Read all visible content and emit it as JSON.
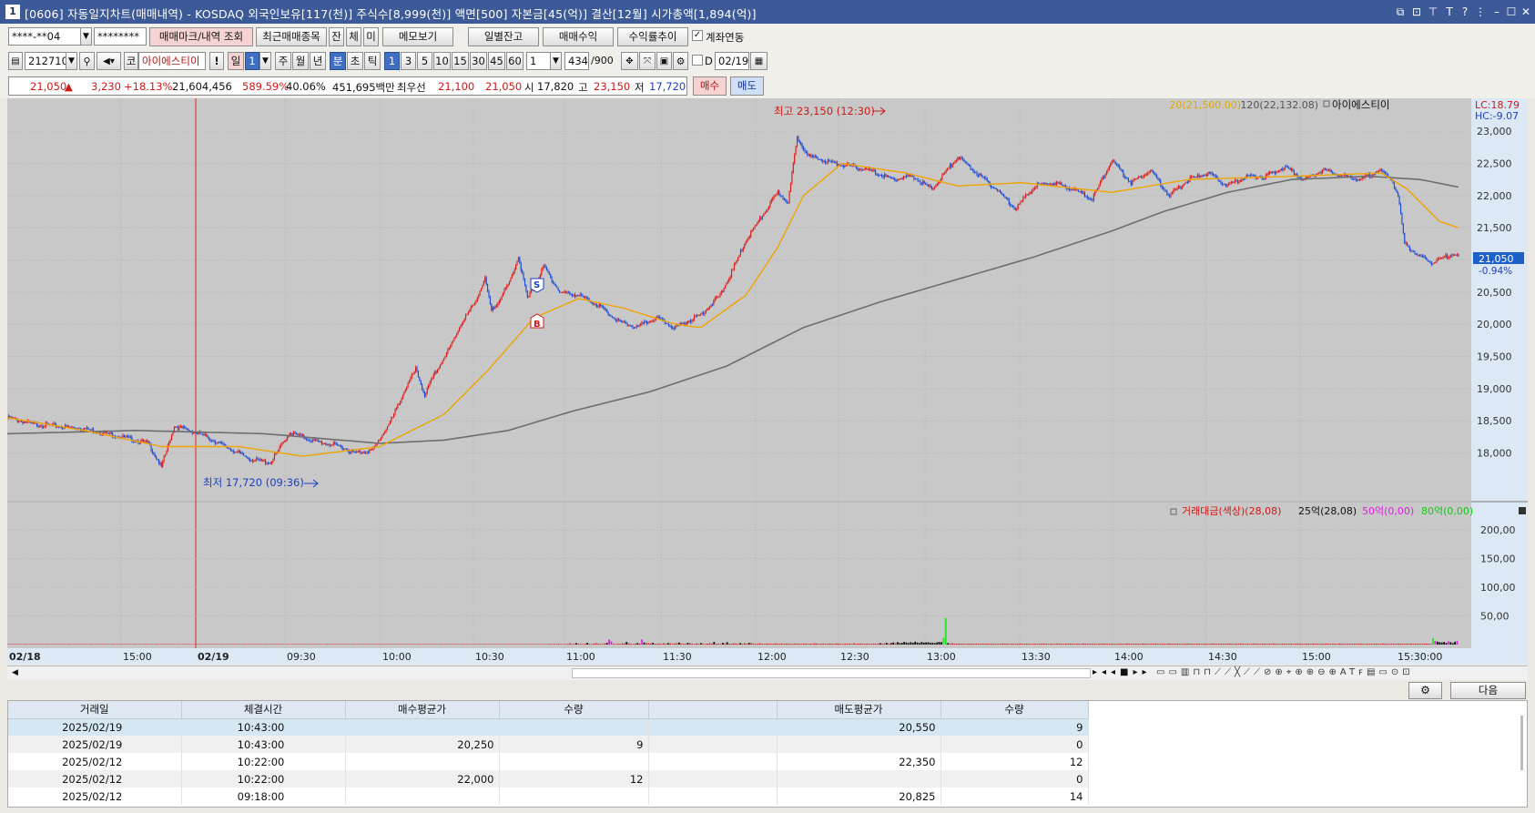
{
  "window": {
    "num": "1",
    "title": "[0606] 자동일지차트(매매내역) - KOSDAQ 외국인보유[117(천)] 주식수[8,999(천)] 액면[500] 자본금[45(억)] 결산[12월] 시가총액[1,894(억)]"
  },
  "toolbar1": {
    "account": "****-**04",
    "password": "********",
    "b1": "매매마크/내역 조회",
    "b2": "최근매매종목",
    "b3": "잔",
    "b4": "체",
    "b5": "미",
    "b6": "메모보기",
    "b7": "일별잔고",
    "b8": "매매수익",
    "b9": "수익률추이",
    "chk": "계좌연동"
  },
  "toolbar2": {
    "code": "212710",
    "mk": "코",
    "name": "아이에스티이",
    "bang": "!",
    "il": "일",
    "ilnum": "1",
    "ju": "주",
    "wol": "월",
    "nyeon": "년",
    "bun": "분",
    "cho": "초",
    "tik": "틱",
    "periods": [
      "1",
      "3",
      "5",
      "10",
      "15",
      "30",
      "45",
      "60"
    ],
    "unit": "1",
    "count": "434",
    "total": "/900",
    "d": "D",
    "date": "02/19"
  },
  "toolbar3": {
    "price": "21,050",
    "arrow": "▲",
    "chg": "3,230",
    "pct": "+18.13%",
    "vol": "21,604,456",
    "volpct": "589.59%",
    "r2": "40.06%",
    "amt": "451,695백만",
    "qlbl": "최우선",
    "ask": "21,100",
    "bid": "21,050",
    "olbl": "시",
    "open": "17,820",
    "hlbl": "고",
    "high": "23,150",
    "llbl": "저",
    "low": "17,720",
    "buy": "매수",
    "sell": "매도"
  },
  "chart_data": {
    "type": "candlestick",
    "legend": {
      "ma20": "20(21,500.00)",
      "ma120": "120(22,132.08)",
      "name": "아이에스티이",
      "lc": "LC:18.79",
      "hc": "HC:-9.07"
    },
    "price_axis": [
      "23,000",
      "22,500",
      "22,000",
      "21,500",
      "21,000",
      "20,500",
      "20,000",
      "19,500",
      "19,000",
      "18,500",
      "18,000"
    ],
    "ylim": [
      17400,
      23200
    ],
    "current": {
      "price": "21,050",
      "pct": "-0.94%",
      "value": 21050
    },
    "annotations": {
      "high": "최고 23,150 (12:30)",
      "low": "최저 17,720 (09:36)",
      "s": "S",
      "b": "B"
    },
    "volume_legend": {
      "title": "거래대금(색상)(28,08)",
      "l25": "25억(28,08)",
      "l50": "50억(0,00)",
      "l80": "80억(0,00)"
    },
    "volume_axis": [
      "200,00",
      "150,00",
      "100,00",
      "50,00"
    ],
    "time_axis": [
      "02/18",
      "15:00",
      "02/19",
      "09:30",
      "10:00",
      "10:30",
      "11:00",
      "11:30",
      "12:00",
      "12:30",
      "13:00",
      "13:30",
      "14:00",
      "14:30",
      "15:00",
      "15:30:00"
    ],
    "path_keypoints": [
      [
        0,
        18550
      ],
      [
        20,
        18450
      ],
      [
        60,
        18380
      ],
      [
        90,
        18250
      ],
      [
        110,
        18150
      ],
      [
        120,
        17780
      ],
      [
        130,
        18420
      ],
      [
        150,
        18300
      ],
      [
        170,
        18100
      ],
      [
        190,
        17900
      ],
      [
        205,
        17850
      ],
      [
        220,
        18320
      ],
      [
        240,
        18180
      ],
      [
        260,
        18100
      ],
      [
        270,
        18000
      ],
      [
        285,
        18050
      ],
      [
        300,
        18550
      ],
      [
        310,
        19000
      ],
      [
        318,
        19300
      ],
      [
        325,
        18900
      ],
      [
        332,
        19200
      ],
      [
        345,
        19650
      ],
      [
        353,
        20000
      ],
      [
        363,
        20300
      ],
      [
        372,
        20700
      ],
      [
        377,
        20200
      ],
      [
        390,
        20600
      ],
      [
        398,
        21050
      ],
      [
        405,
        20400
      ],
      [
        418,
        20900
      ],
      [
        430,
        20500
      ],
      [
        445,
        20450
      ],
      [
        460,
        20300
      ],
      [
        475,
        20050
      ],
      [
        490,
        19950
      ],
      [
        505,
        20100
      ],
      [
        520,
        19950
      ],
      [
        540,
        20150
      ],
      [
        555,
        20450
      ],
      [
        565,
        20850
      ],
      [
        575,
        21300
      ],
      [
        590,
        21750
      ],
      [
        600,
        22050
      ],
      [
        608,
        21900
      ],
      [
        615,
        22900
      ],
      [
        625,
        22600
      ],
      [
        645,
        22500
      ],
      [
        670,
        22400
      ],
      [
        690,
        22250
      ],
      [
        705,
        22300
      ],
      [
        720,
        22100
      ],
      [
        740,
        22600
      ],
      [
        752,
        22400
      ],
      [
        770,
        22100
      ],
      [
        785,
        21800
      ],
      [
        800,
        22150
      ],
      [
        815,
        22200
      ],
      [
        830,
        22100
      ],
      [
        845,
        21950
      ],
      [
        860,
        22550
      ],
      [
        875,
        22200
      ],
      [
        890,
        22400
      ],
      [
        905,
        22000
      ],
      [
        920,
        22250
      ],
      [
        935,
        22350
      ],
      [
        950,
        22150
      ],
      [
        965,
        22300
      ],
      [
        980,
        22300
      ],
      [
        995,
        22450
      ],
      [
        1010,
        22250
      ],
      [
        1025,
        22400
      ],
      [
        1040,
        22300
      ],
      [
        1055,
        22250
      ],
      [
        1068,
        22400
      ],
      [
        1078,
        22250
      ],
      [
        1083,
        22000
      ],
      [
        1088,
        21250
      ],
      [
        1100,
        21050
      ],
      [
        1110,
        20950
      ],
      [
        1125,
        21100
      ],
      [
        1130,
        21050
      ]
    ],
    "ma20_keypoints": [
      [
        0,
        18550
      ],
      [
        60,
        18350
      ],
      [
        120,
        18100
      ],
      [
        180,
        18100
      ],
      [
        230,
        17950
      ],
      [
        290,
        18100
      ],
      [
        340,
        18600
      ],
      [
        375,
        19300
      ],
      [
        410,
        20100
      ],
      [
        445,
        20400
      ],
      [
        480,
        20250
      ],
      [
        520,
        20000
      ],
      [
        540,
        19950
      ],
      [
        575,
        20450
      ],
      [
        600,
        21200
      ],
      [
        620,
        22000
      ],
      [
        650,
        22500
      ],
      [
        700,
        22350
      ],
      [
        740,
        22150
      ],
      [
        790,
        22200
      ],
      [
        860,
        22050
      ],
      [
        920,
        22250
      ],
      [
        1000,
        22300
      ],
      [
        1070,
        22350
      ],
      [
        1090,
        22100
      ],
      [
        1115,
        21600
      ],
      [
        1130,
        21500
      ]
    ],
    "ma120_keypoints": [
      [
        0,
        18300
      ],
      [
        100,
        18350
      ],
      [
        200,
        18300
      ],
      [
        290,
        18150
      ],
      [
        340,
        18200
      ],
      [
        390,
        18350
      ],
      [
        440,
        18650
      ],
      [
        500,
        18950
      ],
      [
        560,
        19350
      ],
      [
        620,
        19950
      ],
      [
        680,
        20350
      ],
      [
        740,
        20700
      ],
      [
        800,
        21050
      ],
      [
        860,
        21450
      ],
      [
        900,
        21750
      ],
      [
        950,
        22050
      ],
      [
        1000,
        22250
      ],
      [
        1060,
        22300
      ],
      [
        1100,
        22250
      ],
      [
        1130,
        22132
      ]
    ],
    "volume_values": [
      1,
      1,
      1,
      1,
      1,
      1,
      1,
      1,
      1,
      1,
      1,
      1,
      1,
      1,
      1,
      1,
      1,
      2,
      1,
      1,
      1,
      1,
      1,
      1,
      1,
      1,
      1,
      1,
      1,
      1,
      1,
      1,
      1,
      1,
      1,
      1,
      1,
      1,
      1,
      1,
      1,
      1,
      1,
      1,
      1,
      1,
      1,
      1,
      1,
      1,
      1,
      1,
      1,
      1,
      1,
      1,
      1,
      1,
      1,
      1,
      1,
      1,
      1,
      2,
      1,
      1,
      1,
      1,
      1,
      1,
      1,
      1,
      1,
      1,
      1,
      1,
      1,
      1,
      1,
      1,
      1,
      1,
      1,
      1,
      1,
      1,
      1,
      1,
      1,
      1,
      1,
      1,
      1,
      1,
      1,
      1,
      1,
      1,
      1,
      1,
      1,
      1,
      1,
      1,
      1,
      1,
      1,
      1,
      1,
      1,
      1,
      1,
      2,
      1,
      1,
      1,
      1,
      1,
      1,
      1,
      1,
      1,
      1,
      1,
      1,
      1,
      1,
      1,
      1,
      1,
      1,
      1,
      1,
      1,
      1,
      1,
      1,
      1,
      1,
      1,
      1,
      1,
      1,
      1,
      1,
      1,
      2,
      1,
      1,
      1,
      1,
      1,
      1,
      1,
      1,
      1,
      1,
      1,
      1,
      1,
      1,
      1,
      1,
      1,
      1,
      1,
      1,
      1,
      1,
      1,
      1,
      1,
      1,
      1,
      1,
      1,
      1,
      1,
      1,
      1,
      1,
      1,
      1,
      1,
      1,
      1,
      1,
      1,
      1,
      1,
      1,
      1,
      1,
      1,
      1,
      1,
      1,
      1,
      1,
      1,
      1,
      1,
      1,
      1,
      1,
      1,
      1,
      1,
      1,
      1,
      1,
      1,
      1,
      1,
      1,
      1,
      1,
      1,
      1,
      1,
      1,
      1,
      1,
      1,
      1,
      1,
      1,
      1,
      1,
      1,
      1,
      1,
      1,
      1,
      1,
      1,
      1,
      1,
      1,
      1,
      1,
      1,
      1,
      1,
      1,
      1,
      1,
      2,
      3,
      2,
      2,
      3,
      4,
      2,
      1,
      2,
      3,
      8,
      2,
      3,
      10,
      5,
      3,
      2,
      4,
      12,
      3,
      2,
      5,
      9,
      4,
      3,
      2,
      6,
      12,
      40,
      25,
      4,
      2,
      5,
      3,
      8,
      6,
      20,
      8,
      4,
      3,
      5,
      10,
      6,
      42,
      15,
      8,
      9,
      7,
      12,
      5,
      4,
      6,
      3,
      8,
      5,
      10,
      7,
      3,
      6,
      9,
      15,
      6,
      4,
      3,
      12,
      8,
      5,
      2,
      7,
      4,
      10,
      6,
      3,
      5,
      8,
      5,
      20,
      4,
      6,
      3,
      12,
      6,
      18,
      4,
      5,
      8,
      6,
      3,
      10,
      5,
      8,
      4,
      12,
      9,
      6,
      3,
      5,
      8,
      4,
      3,
      6,
      5,
      4,
      3,
      8,
      5,
      4,
      6,
      3,
      7,
      5,
      4,
      3,
      6,
      5,
      4,
      3,
      6,
      4,
      3,
      5,
      4,
      8,
      6,
      3,
      4,
      5,
      3,
      4,
      6,
      4,
      3,
      7,
      5,
      4,
      3,
      6,
      4,
      5,
      3,
      8,
      4,
      5,
      6,
      4,
      3,
      5,
      4,
      3,
      6,
      4,
      5,
      10,
      5,
      8,
      12,
      5,
      10,
      15,
      8,
      18,
      10,
      12,
      20,
      15,
      10,
      18,
      12,
      22,
      15,
      10,
      20,
      14,
      16,
      18,
      12,
      14,
      10,
      16,
      20,
      18,
      55,
      228,
      10,
      6,
      8,
      5,
      4,
      6,
      5,
      4,
      3,
      5,
      4,
      6,
      3,
      5,
      4,
      3,
      6,
      4,
      5,
      3,
      4,
      5,
      3,
      4,
      3,
      6,
      5,
      4,
      3,
      5,
      4,
      3,
      5,
      6,
      4,
      3,
      5,
      4,
      3,
      4,
      5,
      3,
      4,
      6,
      5,
      4,
      3,
      5,
      4,
      3,
      6,
      5,
      4,
      3,
      5,
      4,
      6,
      4,
      3,
      5,
      4,
      3,
      6,
      5,
      4,
      3,
      5,
      4,
      3,
      5,
      4,
      6,
      5,
      4,
      3,
      5,
      4,
      3,
      4,
      5,
      3,
      4,
      6,
      5,
      4,
      3,
      5,
      4,
      3,
      6,
      5,
      4,
      3,
      5,
      4,
      6,
      4,
      3,
      5,
      4,
      3,
      6,
      5,
      4,
      3,
      5,
      4,
      3,
      5,
      4,
      6,
      5,
      4,
      3,
      5,
      4,
      3,
      4,
      5,
      3,
      4,
      6,
      5,
      4,
      3,
      5,
      4,
      3,
      6,
      5,
      4,
      3,
      5,
      4,
      6,
      4,
      3,
      5,
      4,
      3,
      6,
      5,
      4,
      3,
      5,
      4,
      3,
      5,
      4,
      6,
      5,
      4,
      3,
      5,
      4,
      3,
      4,
      5,
      3,
      4,
      6,
      5,
      4,
      3,
      5,
      4,
      3,
      6,
      5,
      4,
      3,
      5,
      4,
      6,
      4,
      3,
      5,
      4,
      3,
      6,
      5,
      4,
      3,
      5,
      4,
      3,
      5,
      4,
      6,
      5,
      4,
      3,
      5,
      4,
      3,
      4,
      5,
      3,
      4,
      6,
      5,
      4,
      3,
      5,
      4,
      3,
      6,
      5,
      4,
      3,
      5,
      4,
      6,
      4,
      3,
      5,
      4,
      3,
      6,
      5,
      4,
      3,
      52,
      28,
      22,
      18,
      15,
      20,
      12,
      25,
      18,
      10,
      22,
      28
    ]
  },
  "grid": {
    "headers": [
      "거래일",
      "체결시간",
      "매수평균가",
      "수량",
      "",
      "매도평균가",
      "수량"
    ],
    "rows": [
      [
        "2025/02/19",
        "10:43:00",
        "",
        "",
        "",
        "20,550",
        "9"
      ],
      [
        "2025/02/19",
        "10:43:00",
        "20,250",
        "9",
        "",
        "",
        "0"
      ],
      [
        "2025/02/12",
        "10:22:00",
        "",
        "",
        "",
        "22,350",
        "12"
      ],
      [
        "2025/02/12",
        "10:22:00",
        "22,000",
        "12",
        "",
        "",
        "0"
      ],
      [
        "2025/02/12",
        "09:18:00",
        "",
        "",
        "",
        "20,825",
        "14"
      ]
    ],
    "next": "다음"
  }
}
